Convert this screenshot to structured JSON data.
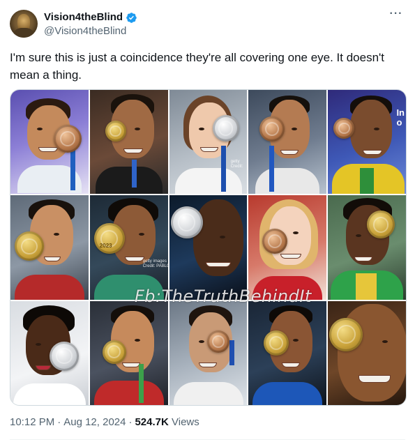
{
  "author": {
    "display_name": "Vision4theBlind",
    "handle": "@Vision4theBlind",
    "verified": true,
    "verified_color": "#1d9bf0"
  },
  "tweet": {
    "text": "I'm sure this is just a coincidence they're all covering one eye. It doesn't mean a thing.",
    "more_icon": "more-horizontal-icon"
  },
  "media": {
    "watermark": "Fb:TheTruthBehindIt",
    "photos": [
      {
        "medal": "bronze"
      },
      {
        "medal": "gold"
      },
      {
        "medal": "silver"
      },
      {
        "medal": "bronze"
      },
      {
        "medal": "bronze"
      },
      {
        "medal": "gold"
      },
      {
        "medal": "gold"
      },
      {
        "medal": "silver"
      },
      {
        "medal": "bronze"
      },
      {
        "medal": "gold"
      },
      {
        "medal": "silver"
      },
      {
        "medal": "gold"
      },
      {
        "medal": "bronze"
      },
      {
        "medal": "gold"
      },
      {
        "medal": "gold"
      }
    ],
    "side_text": "In\no",
    "medal_text": "2023",
    "getty_label_1": "getty\nCredit:",
    "getty_label_2": "getty images\nCredit: PABLO VER"
  },
  "meta": {
    "time": "10:12 PM",
    "date": "Aug 12, 2024",
    "views_count": "524.7K",
    "views_label": "Views"
  }
}
